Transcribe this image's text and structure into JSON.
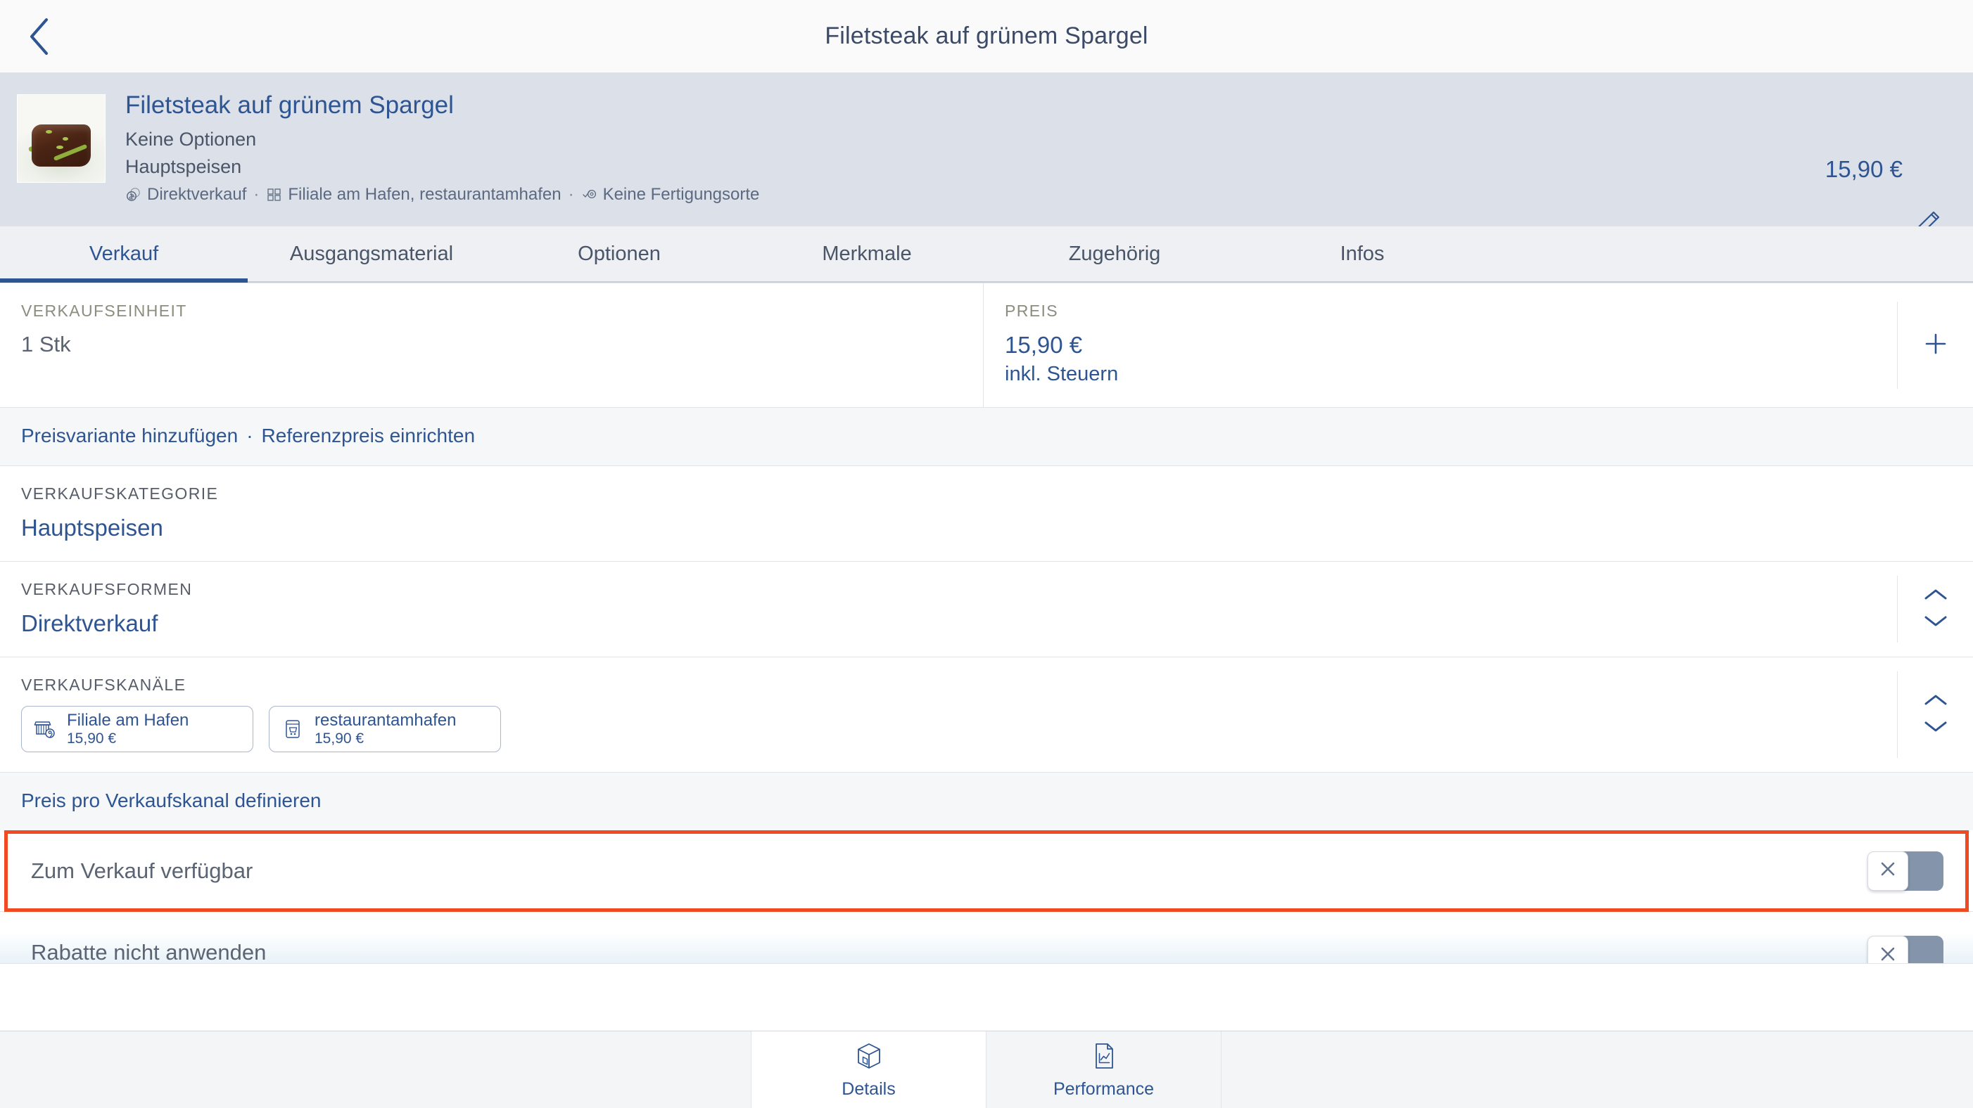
{
  "navbar": {
    "back_icon": "chevron-left-icon",
    "title": "Filetsteak auf grünem Spargel"
  },
  "product": {
    "name": "Filetsteak auf grünem Spargel",
    "options": "Keine Optionen",
    "category": "Hauptspeisen",
    "price": "15,90 €",
    "meta": {
      "sales_form": "Direktverkauf",
      "channels": "Filiale am Hafen, restaurantamhafen",
      "production": "Keine Fertigungsorte",
      "separator": "·"
    },
    "edit_icon": "pencil-icon"
  },
  "tabs": [
    {
      "label": "Verkauf",
      "active": true
    },
    {
      "label": "Ausgangsmaterial",
      "active": false
    },
    {
      "label": "Optionen",
      "active": false
    },
    {
      "label": "Merkmale",
      "active": false
    },
    {
      "label": "Zugehörig",
      "active": false
    },
    {
      "label": "Infos",
      "active": false
    }
  ],
  "sales": {
    "unit_label": "VERKAUFSEINHEIT",
    "unit_value": "1 Stk",
    "price_label": "PREIS",
    "price_value": "15,90 €",
    "price_tax": "inkl. Steuern",
    "add_price_icon": "plus-icon",
    "links": {
      "add_variant": "Preisvariante hinzufügen",
      "separator": "·",
      "reference_price": "Referenzpreis einrichten"
    },
    "category_label": "VERKAUFSKATEGORIE",
    "category_value": "Hauptspeisen",
    "forms_label": "VERKAUFSFORMEN",
    "forms_value": "Direktverkauf",
    "channels_label": "VERKAUFSKANÄLE",
    "channels": [
      {
        "name": "Filiale am Hafen",
        "price": "15,90 €",
        "icon": "store-location-icon"
      },
      {
        "name": "restaurantamhafen",
        "price": "15,90 €",
        "icon": "online-shop-icon"
      }
    ],
    "channel_price_link": "Preis pro Verkaufskanal definieren",
    "stepper_icon": "chevron-up-down-icon"
  },
  "toggles": [
    {
      "label": "Zum Verkauf verfügbar",
      "state": "off",
      "knob_icon": "close-x-icon",
      "highlighted": true
    },
    {
      "label": "Rabatte nicht anwenden",
      "state": "off",
      "knob_icon": "close-x-icon",
      "highlighted": false
    }
  ],
  "bottom_tabs": [
    {
      "label": "Details",
      "icon": "box-3d-icon",
      "active": true
    },
    {
      "label": "Performance",
      "icon": "document-chart-icon",
      "active": false
    }
  ],
  "colors": {
    "accent_blue": "#2e5592",
    "header_bg": "#dce0e9",
    "highlight_red": "#f04a23",
    "toggle_track": "#8394ab",
    "label_olive": "#8b8d7e"
  }
}
